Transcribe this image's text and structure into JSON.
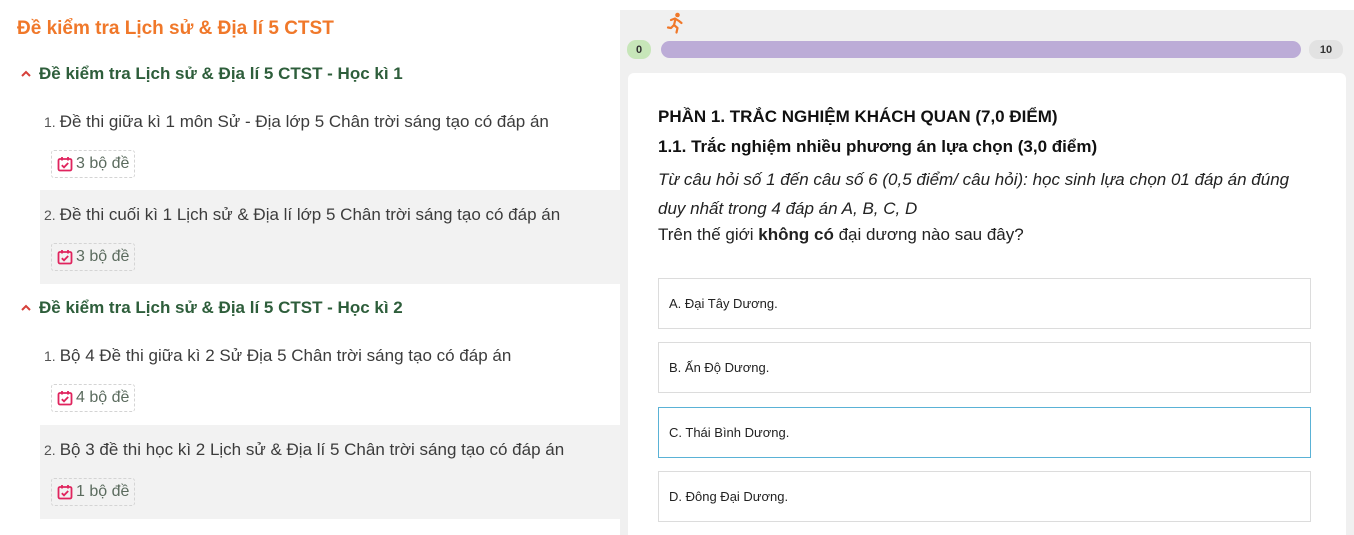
{
  "left": {
    "title": "Đề kiểm tra Lịch sử & Địa lí 5 CTST",
    "sections": [
      {
        "heading": "Đề kiểm tra Lịch sử & Địa lí 5 CTST - Học kì 1",
        "items": [
          {
            "num": "1.",
            "title": "Đề thi giữa kì 1 môn Sử - Địa lớp 5 Chân trời sáng tạo có đáp án",
            "count": "3 bộ đề"
          },
          {
            "num": "2.",
            "title": "Đề thi cuối kì 1 Lịch sử & Địa lí lớp 5 Chân trời sáng tạo có đáp án",
            "count": "3 bộ đề"
          }
        ]
      },
      {
        "heading": "Đề kiểm tra Lịch sử & Địa lí 5 CTST - Học kì 2",
        "items": [
          {
            "num": "1.",
            "title": "Bộ 4 Đề thi giữa kì 2 Sử Địa 5 Chân trời sáng tạo có đáp án",
            "count": "4 bộ đề"
          },
          {
            "num": "2.",
            "title": "Bộ 3 đề thi học kì 2 Lịch sử & Địa lí 5 Chân trời sáng tạo có đáp án",
            "count": "1 bộ đề"
          }
        ]
      }
    ]
  },
  "quiz": {
    "progress": {
      "start": "0",
      "end": "10",
      "current": 0
    },
    "part_heading": "PHẦN 1. TRẮC NGHIỆM KHÁCH QUAN (7,0 ĐIỂM)",
    "sub_heading": "1.1. Trắc nghiệm nhiều phương án lựa chọn (3,0 điểm)",
    "instruction": "Từ câu hỏi số 1 đến câu số 6 (0,5 điểm/ câu hỏi): học sinh lựa chọn 01 đáp án đúng duy nhất trong 4 đáp án A, B, C, D",
    "question_pre": "Trên thế giới ",
    "question_bold": "không có",
    "question_post": " đại dương nào sau đây?",
    "options": [
      "A. Đại Tây Dương.",
      "B. Ấn Độ Dương.",
      "C. Thái Bình Dương.",
      "D. Đông Đại Dương."
    ],
    "colors": {
      "accent_orange": "#f0782a",
      "section_green": "#2e5e3b",
      "progress_purple": "#bcacd7",
      "active_border": "#5ab2d6",
      "calendar_red": "#e0245e"
    }
  }
}
